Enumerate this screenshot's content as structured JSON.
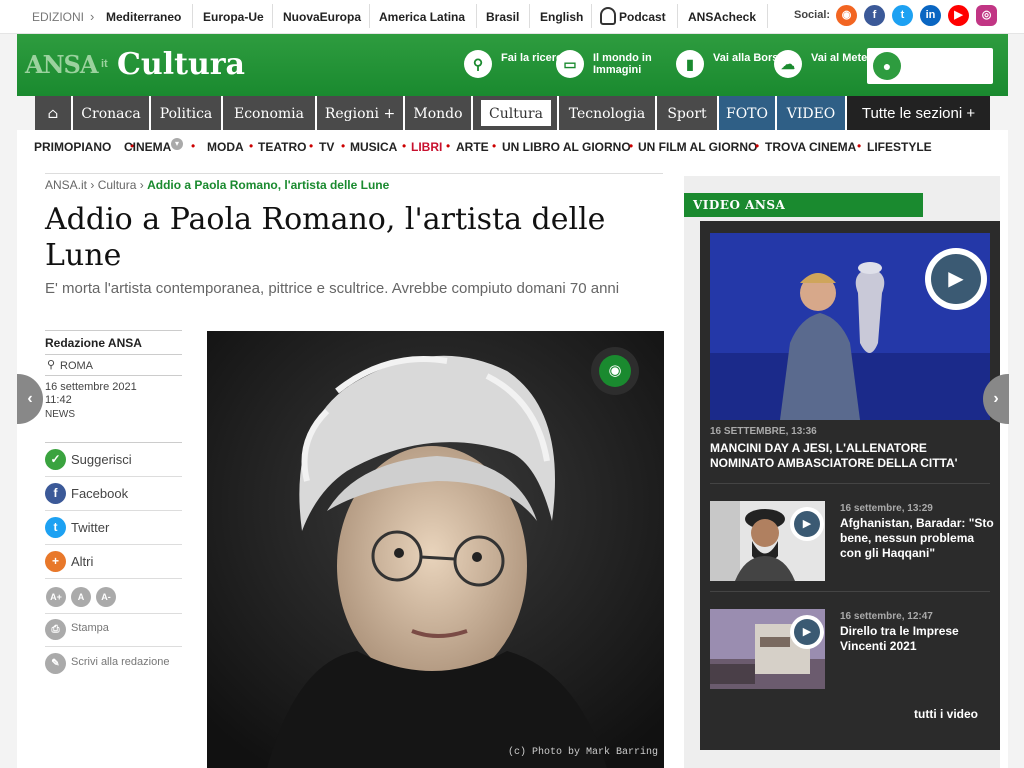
{
  "editions": {
    "label": "EDIZIONI",
    "items": [
      "Mediterraneo",
      "Europa-Ue",
      "NuovaEuropa",
      "America Latina",
      "Brasil",
      "English",
      "Podcast",
      "ANSAcheck"
    ],
    "social_label": "Social:",
    "social_icons": [
      "rss-icon",
      "facebook-icon",
      "twitter-icon",
      "linkedin-icon",
      "youtube-icon",
      "instagram-icon"
    ]
  },
  "header": {
    "logo_main": "ANSA",
    "logo_suffix": "it",
    "section": "Cultura",
    "quick_links": [
      {
        "icon": "search-icon",
        "label": "Fai la ricerca"
      },
      {
        "icon": "photo-icon",
        "label": "Il mondo in Immagini"
      },
      {
        "icon": "chart-icon",
        "label": "Vai alla Borsa"
      },
      {
        "icon": "weather-icon",
        "label": "Vai al Meteo"
      }
    ]
  },
  "nav": {
    "items": [
      "Cronaca",
      "Politica",
      "Economia",
      "Regioni +",
      "Mondo",
      "Cultura",
      "Tecnologia",
      "Sport",
      "FOTO",
      "VIDEO",
      "Tutte le sezioni +"
    ],
    "active": "Cultura"
  },
  "subnav": {
    "items": [
      "PRIMOPIANO",
      "CINEMA",
      "MODA",
      "TEATRO",
      "TV",
      "MUSICA",
      "LIBRI",
      "ARTE",
      "UN LIBRO AL GIORNO",
      "UN FILM AL GIORNO",
      "TROVA CINEMA",
      "LIFESTYLE"
    ],
    "highlight": "LIBRI"
  },
  "breadcrumb": {
    "items": [
      "ANSA.it",
      "Cultura"
    ],
    "current": "Addio a Paola Romano, l'artista delle Lune"
  },
  "article": {
    "title": "Addio a Paola Romano, l'artista delle Lune",
    "subtitle": "E' morta l'artista contemporanea, pittrice e scultrice. Avrebbe compiuto domani 70 anni",
    "author": "Redazione ANSA",
    "location": "ROMA",
    "date": "16 settembre 2021",
    "time": "11:42",
    "category": "NEWS",
    "photo_credit": "(c) Photo by Mark Barring"
  },
  "share": {
    "items": [
      {
        "icon": "thumb-icon",
        "label": "Suggerisci",
        "color": "#3aa33f"
      },
      {
        "icon": "facebook-icon",
        "label": "Facebook",
        "color": "#3b5998"
      },
      {
        "icon": "twitter-icon",
        "label": "Twitter",
        "color": "#1da1f2"
      },
      {
        "icon": "plus-icon",
        "label": "Altri",
        "color": "#e8782a"
      }
    ],
    "font_buttons": [
      "A+",
      "A",
      "A-"
    ],
    "print_label": "Stampa",
    "write_label": "Scrivi alla redazione"
  },
  "video": {
    "heading": "VIDEO ANSA",
    "featured": {
      "date": "16 SETTEMBRE, 13:36",
      "title": "MANCINI DAY A JESI, L'ALLENATORE NOMINATO AMBASCIATORE DELLA CITTA'"
    },
    "items": [
      {
        "date": "16 settembre, 13:29",
        "title": "Afghanistan, Baradar: \"Sto bene, nessun problema con gli Haqqani\""
      },
      {
        "date": "16 settembre, 12:47",
        "title": "Direllо tra le Imprese Vincenti 2021"
      }
    ],
    "all_label": "tutti i video"
  }
}
